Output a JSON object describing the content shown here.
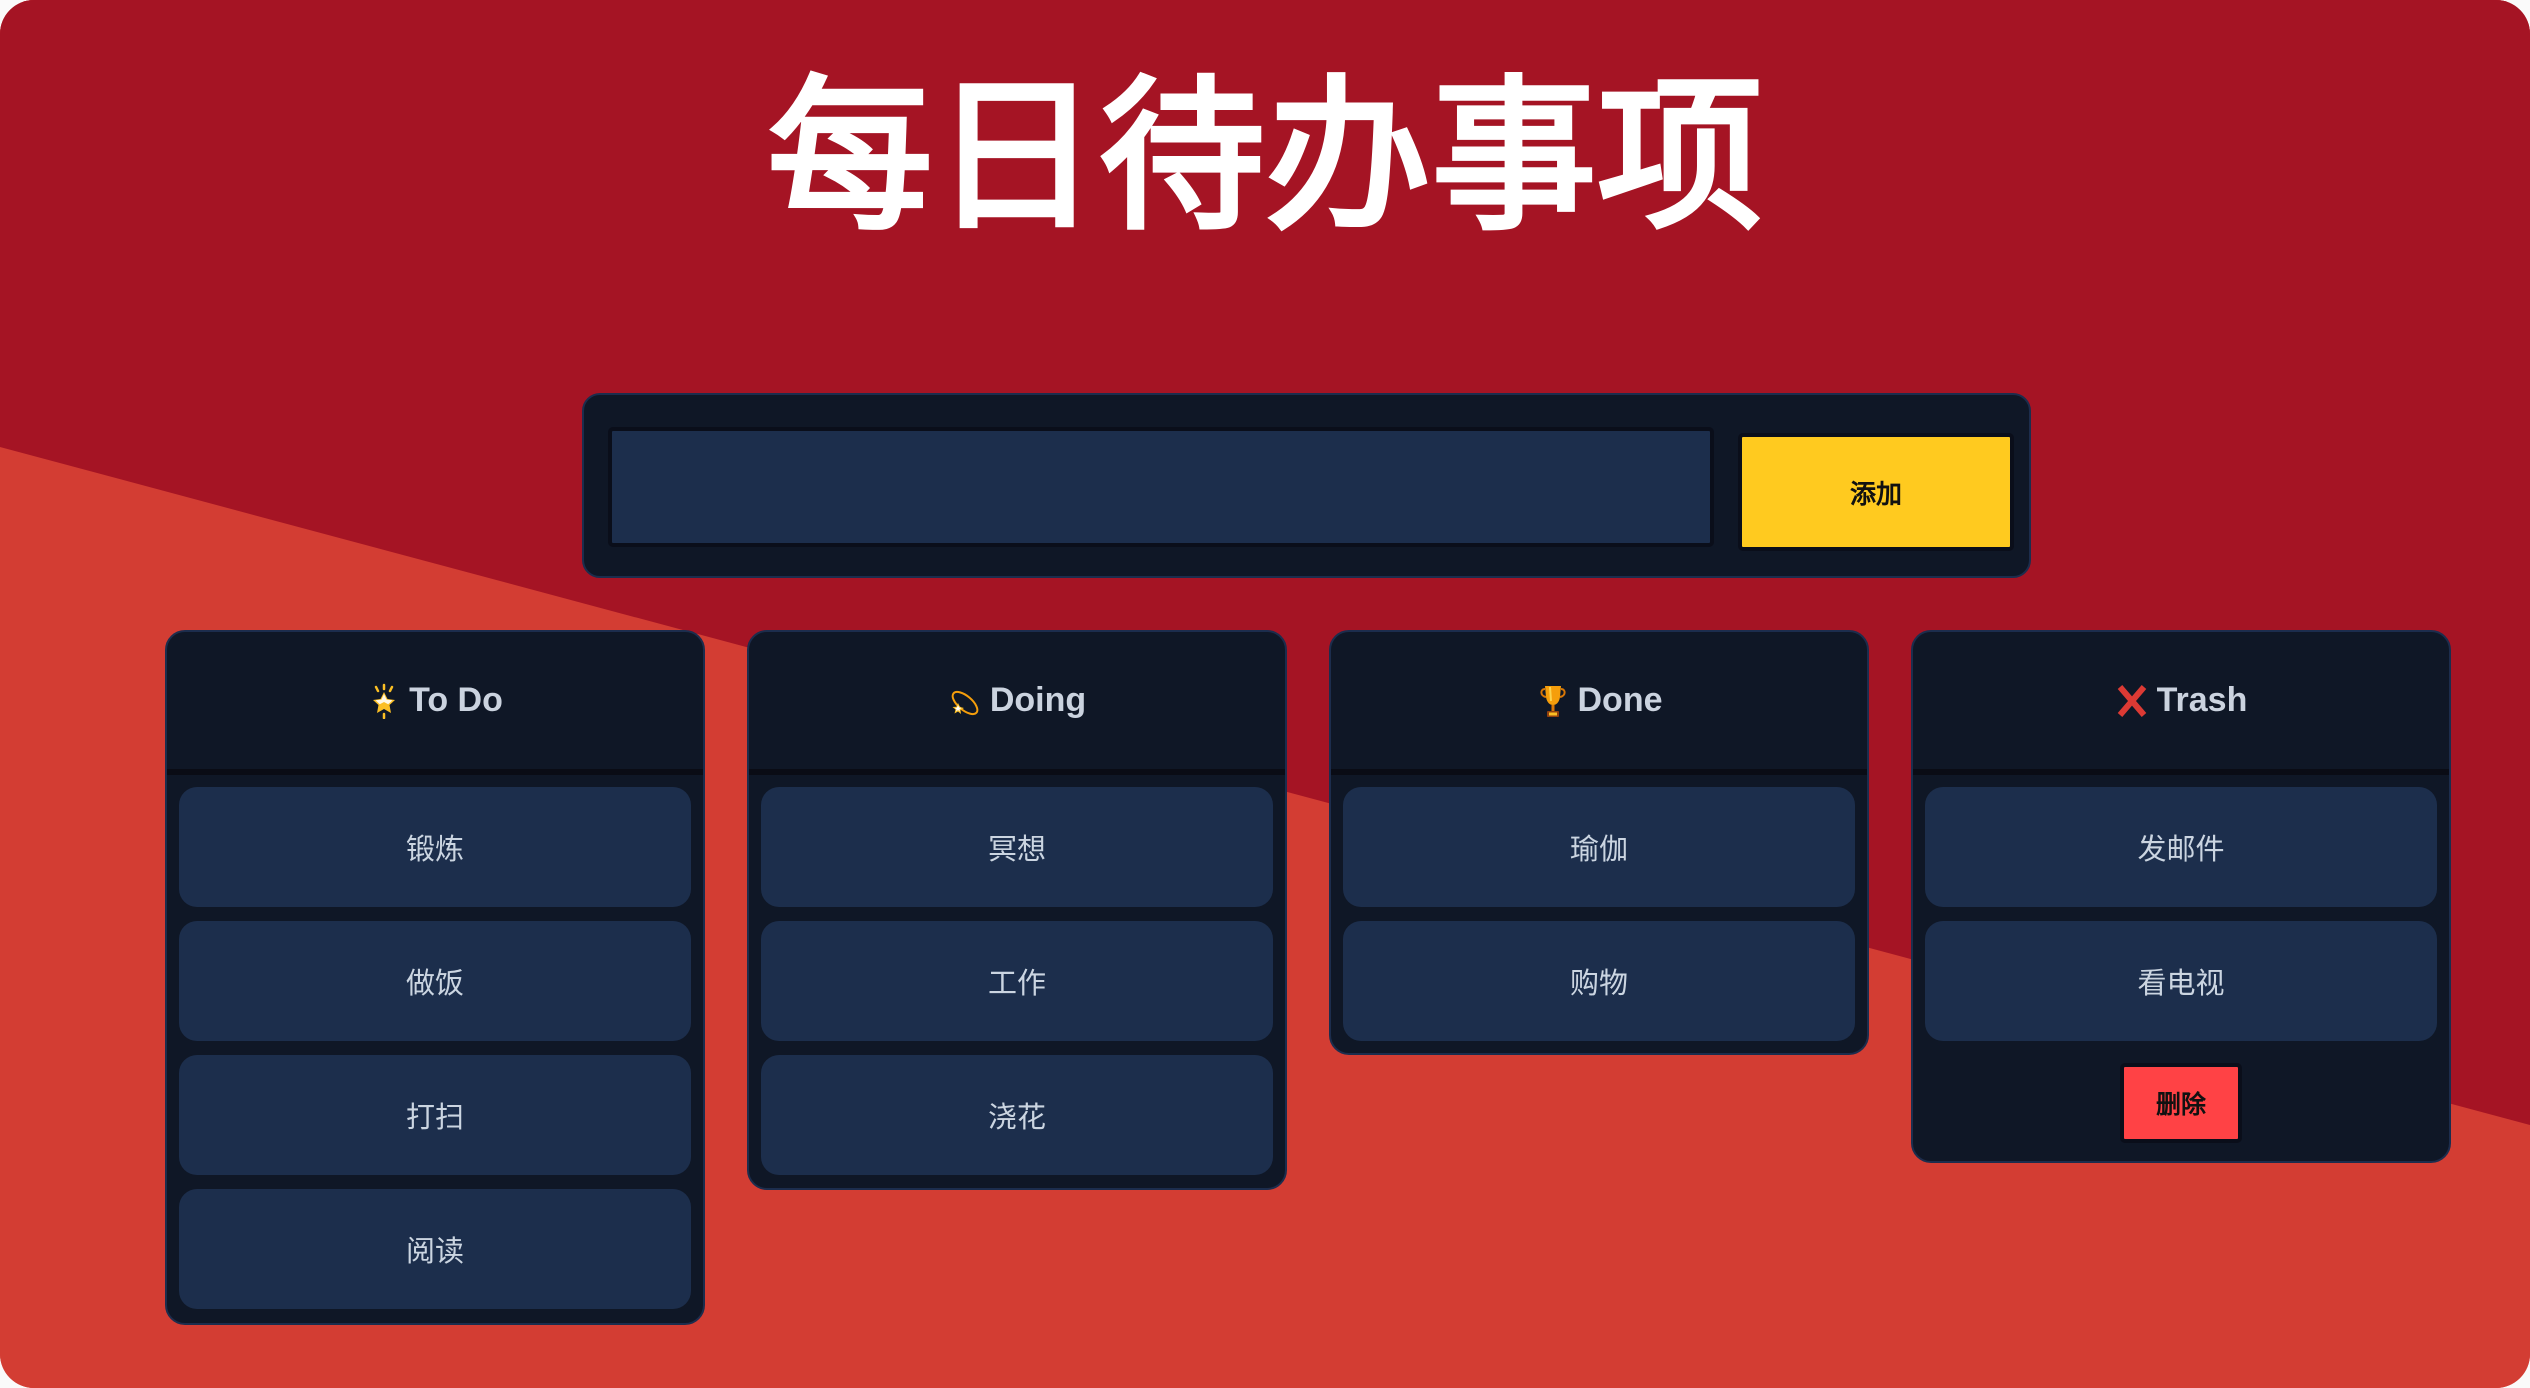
{
  "app": {
    "title": "每日待办事项",
    "colors": {
      "background_top": "#a51424",
      "background_bottom": "#d33d33",
      "panel": "#0f1726",
      "item": "#1c2e4c",
      "add_button": "#ffca1f",
      "delete_button": "#ff4245",
      "text": "#cbd5e1"
    }
  },
  "input": {
    "value": "",
    "placeholder": "",
    "add_label": "添加"
  },
  "columns": [
    {
      "id": "todo",
      "icon": "glowing-star-icon",
      "title": "To Do",
      "items": [
        "锻炼",
        "做饭",
        "打扫",
        "阅读"
      ]
    },
    {
      "id": "doing",
      "icon": "dizzy-icon",
      "title": "Doing",
      "items": [
        "冥想",
        "工作",
        "浇花"
      ]
    },
    {
      "id": "done",
      "icon": "trophy-icon",
      "title": "Done",
      "items": [
        "瑜伽",
        "购物"
      ]
    },
    {
      "id": "trash",
      "icon": "cross-mark-icon",
      "title": "Trash",
      "items": [
        "发邮件",
        "看电视"
      ],
      "delete_label": "删除"
    }
  ]
}
